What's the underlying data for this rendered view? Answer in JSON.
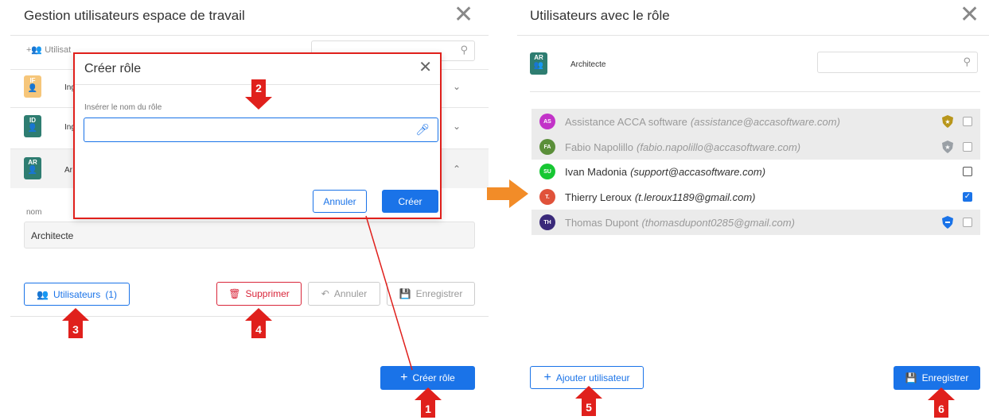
{
  "left_panel": {
    "title": "Gestion utilisateurs espace de travail",
    "toolbar_users": "Utilisat",
    "rows": [
      {
        "badge": "IF",
        "badge_color": "#f6c67a",
        "label": "Ing"
      },
      {
        "badge": "ID",
        "badge_color": "#2e7d71",
        "label": "Ing"
      },
      {
        "badge": "AR",
        "badge_color": "#2e7d71",
        "label": "Ar"
      }
    ],
    "name_label": "nom",
    "name_value": "Architecte",
    "users_button": "Utilisateurs",
    "users_count": "(1)",
    "delete_button": "Supprimer",
    "cancel_button": "Annuler",
    "save_button": "Enregistrer",
    "create_role_button": "Créer rôle"
  },
  "modal": {
    "title": "Créer rôle",
    "field_label": "Insérer le nom du rôle",
    "field_value": "",
    "cancel": "Annuler",
    "create": "Créer"
  },
  "right_panel": {
    "title": "Utilisateurs avec le rôle",
    "role_badge": "AR",
    "role_name": "Architecte",
    "users": [
      {
        "initials": "AS",
        "color": "#c233c8",
        "name": "Assistance ACCA software",
        "email": "(assistance@accasoftware.com)",
        "disabled": true,
        "checked": false,
        "shield": "gold"
      },
      {
        "initials": "FA",
        "color": "#5b8f3a",
        "name": "Fabio Napolillo",
        "email": "(fabio.napolillo@accasoftware.com)",
        "disabled": true,
        "checked": false,
        "shield": "silver"
      },
      {
        "initials": "SU",
        "color": "#17c733",
        "name": "Ivan Madonia",
        "email": "(support@accasoftware.com)",
        "disabled": false,
        "checked": false,
        "shield": ""
      },
      {
        "initials": "T.",
        "color": "#e0523a",
        "name": "Thierry Leroux",
        "email": "(t.leroux1189@gmail.com)",
        "disabled": false,
        "checked": true,
        "shield": ""
      },
      {
        "initials": "TH",
        "color": "#3a2a7a",
        "name": "Thomas Dupont",
        "email": "(thomasdupont0285@gmail.com)",
        "disabled": true,
        "checked": false,
        "shield": "blue"
      }
    ],
    "add_user_button": "Ajouter utilisateur",
    "save_button": "Enregistrer"
  },
  "markers": [
    "1",
    "2",
    "3",
    "4",
    "5",
    "6"
  ],
  "colors": {
    "accent": "#1a73e8",
    "danger": "#d9263a",
    "marker": "#e0201c",
    "orange_arrow": "#f28c28"
  }
}
